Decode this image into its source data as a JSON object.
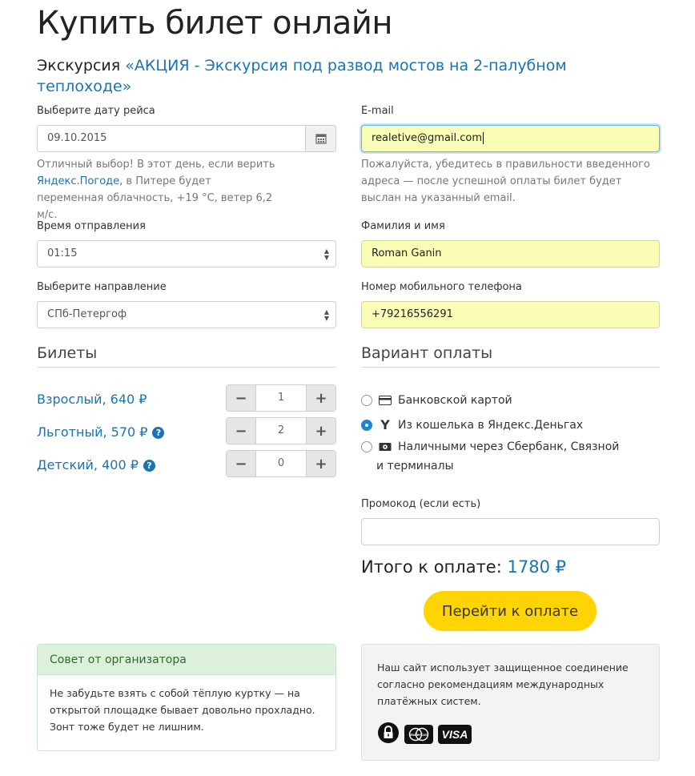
{
  "page": {
    "title": "Купить билет онлайн",
    "excursion_prefix": "Экскурсия",
    "excursion_name": "«АКЦИЯ - Экскурсия под развод мостов на 2-палубном теплоходе»"
  },
  "left": {
    "date_label": "Выберите дату рейса",
    "date_value": "09.10.2015",
    "weather_text_1": "Отличный выбор! В этот день, если верить",
    "weather_link": "Яндекс.Погоде",
    "weather_text_2": ", в Питере будет переменная облачность, +19 °С, ветер 6,2 м/с.",
    "time_label": "Время отправления",
    "time_value": "01:15",
    "direction_label": "Выберите направление",
    "direction_value": "СПб-Петергоф",
    "tickets_title": "Билеты",
    "tickets": [
      {
        "label": "Взрослый, 640 ₽",
        "qty": "1",
        "help": false
      },
      {
        "label": "Льготный, 570 ₽",
        "qty": "2",
        "help": true
      },
      {
        "label": "Детский, 400 ₽",
        "qty": "0",
        "help": true
      }
    ],
    "help_glyph": "?",
    "minus_glyph": "−",
    "plus_glyph": "+"
  },
  "right": {
    "email_label": "E-mail",
    "email_value": "realetive@gmail.com",
    "email_help": "Пожалуйста, убедитесь в правильности введенного адреса — после успешной оплаты билет будет выслан на указанный email.",
    "name_label": "Фамилия и имя",
    "name_value": "Roman Ganin",
    "phone_label": "Номер мобильного телефона",
    "phone_value": "+79216556291",
    "payment_title": "Вариант оплаты",
    "payment_options": [
      {
        "label": "Банковской картой",
        "icon": "credit-card-icon",
        "checked": false
      },
      {
        "label": "Из кошелька в Яндекс.Деньгах",
        "icon": "yandex-money-icon",
        "checked": true
      },
      {
        "label": "Наличными через Сбербанк, Связной",
        "label_2": "и терминалы",
        "icon": "cash-icon",
        "checked": false
      }
    ],
    "promo_label": "Промокод (если есть)",
    "promo_value": "",
    "total_label": "Итого к оплате:",
    "total_value": "1780 ₽",
    "pay_button": "Перейти к оплате"
  },
  "tip": {
    "title": "Совет от организатора",
    "text": "Не забудьте взять с собой тёплую куртку — на открытой площадке бывает довольно прохладно. Зонт тоже будет не лишним."
  },
  "secure": {
    "text": "Наш сайт использует защищенное соединение согласно рекомендациям международных платёжных систем.",
    "mastercard_text": "MasterCard",
    "visa_text": "VISA"
  },
  "colors": {
    "link": "#1a73b5",
    "autofill": "#fafdb5",
    "pay_button": "#ffd400",
    "tip_header": "#dcf0dc"
  }
}
